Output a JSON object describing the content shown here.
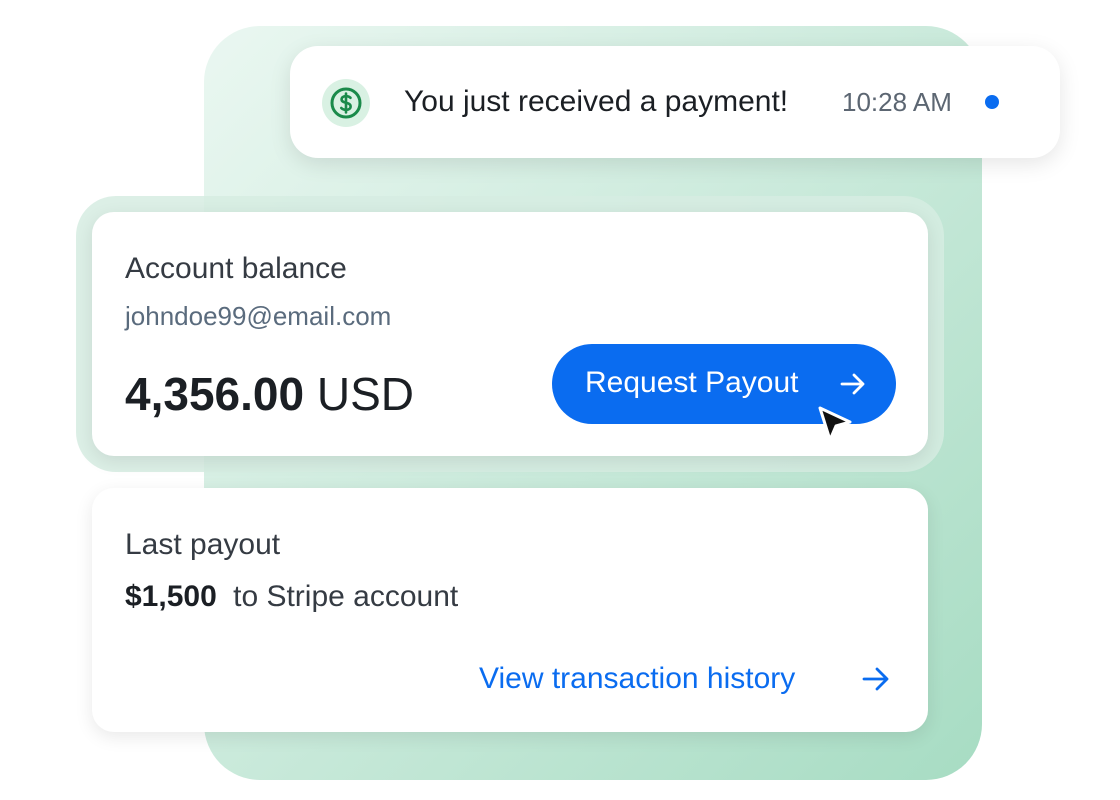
{
  "notification": {
    "icon": "dollar-coin-icon",
    "message": "You just received a payment!",
    "time": "10:28 AM",
    "unread": true
  },
  "balance_card": {
    "title": "Account balance",
    "email": "johndoe99@email.com",
    "amount": "4,356.00",
    "currency": "USD",
    "button_label": "Request Payout",
    "button_icon": "arrow-right-icon"
  },
  "payout_card": {
    "title": "Last payout",
    "amount": "$1,500",
    "destination": "to Stripe account",
    "link_label": "View transaction history",
    "link_icon": "arrow-right-icon"
  },
  "colors": {
    "accent": "#0a6cf0",
    "success": "#1a8a4a",
    "background_gradient_end": "#a7dcc3"
  }
}
